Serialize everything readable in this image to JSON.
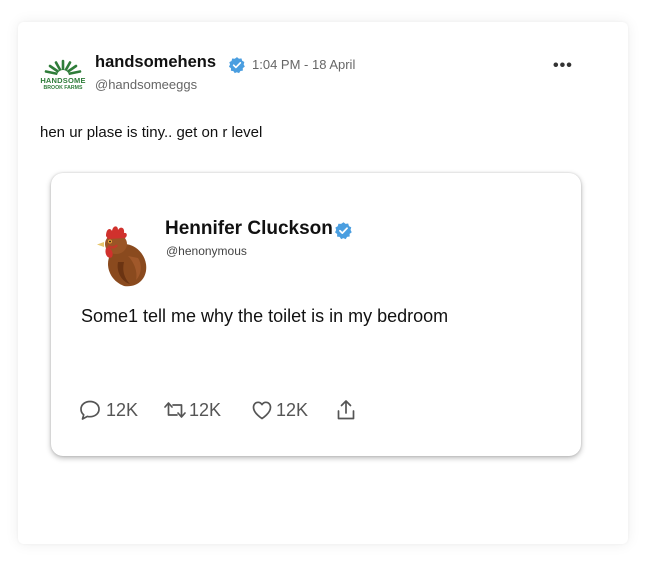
{
  "tweet": {
    "display_name": "handsomehens",
    "handle": "@handsomeeggs",
    "timestamp": "1:04 PM - 18 April",
    "text": "hen ur plase is tiny.. get on r level",
    "more_label": "•••",
    "logo_line1": "HANDSOME",
    "logo_line2": "BROOK FARMS"
  },
  "quoted": {
    "display_name": "Hennifer Cluckson",
    "handle": "@henonymous",
    "text": "Some1 tell me why the toilet is in my bedroom",
    "actions": {
      "reply_count": "12K",
      "retweet_count": "12K",
      "like_count": "12K"
    }
  },
  "colors": {
    "verified": "#4a9ee0",
    "logo_green": "#2f7d3a"
  }
}
